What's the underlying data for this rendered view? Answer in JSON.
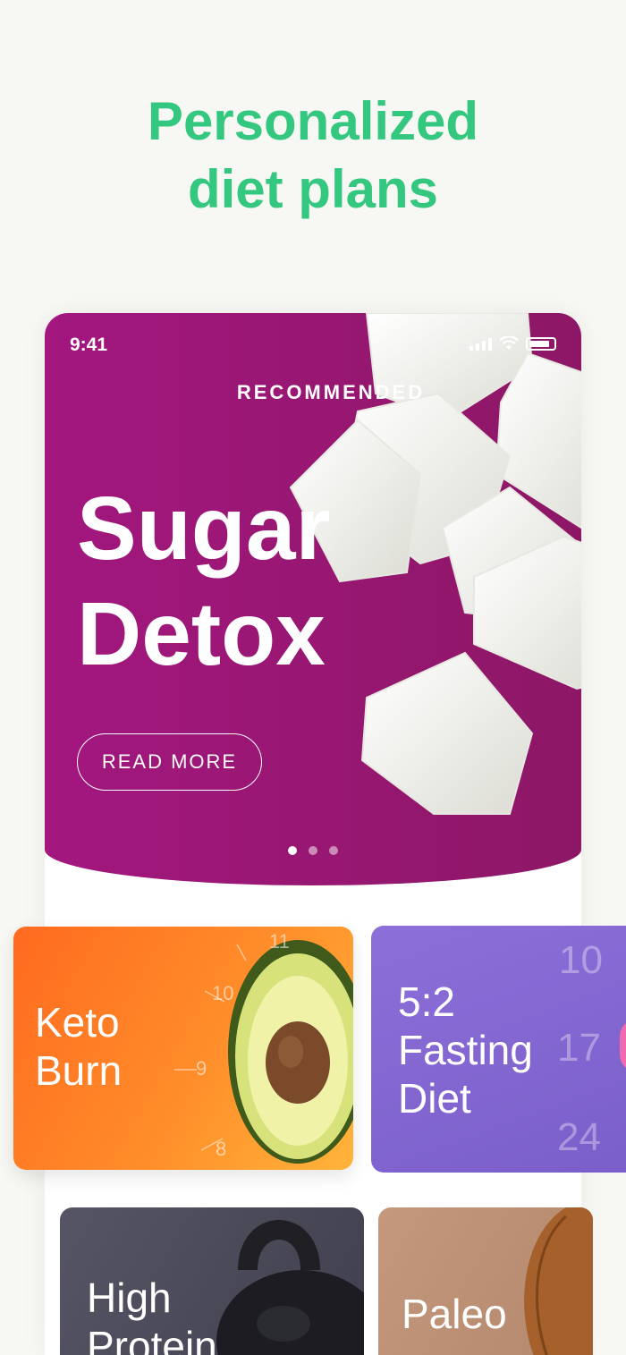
{
  "headline": {
    "line1": "Personalized",
    "line2": "diet plans"
  },
  "status_bar": {
    "time": "9:41"
  },
  "hero": {
    "label": "RECOMMENDED",
    "title_line1": "Sugar",
    "title_line2": "Detox",
    "button": "READ MORE",
    "pager": {
      "count": 3,
      "active": 1
    }
  },
  "cards": {
    "keto": {
      "line1": "Keto",
      "line2": "Burn",
      "dial": [
        "11",
        "10",
        "9",
        "8"
      ]
    },
    "fasting": {
      "line1": "5:2",
      "line2": "Fasting",
      "line3": "Diet",
      "dial": [
        "10",
        "17",
        "24"
      ]
    },
    "protein": {
      "line1": "High",
      "line2": "Protein"
    },
    "paleo": {
      "line1": "Paleo"
    }
  },
  "colors": {
    "headline": "#34c77f",
    "hero": "#9b1678",
    "keto": "#ff8a2a",
    "fasting": "#8268d0",
    "protein": "#4a4957",
    "paleo": "#bb8f73"
  }
}
